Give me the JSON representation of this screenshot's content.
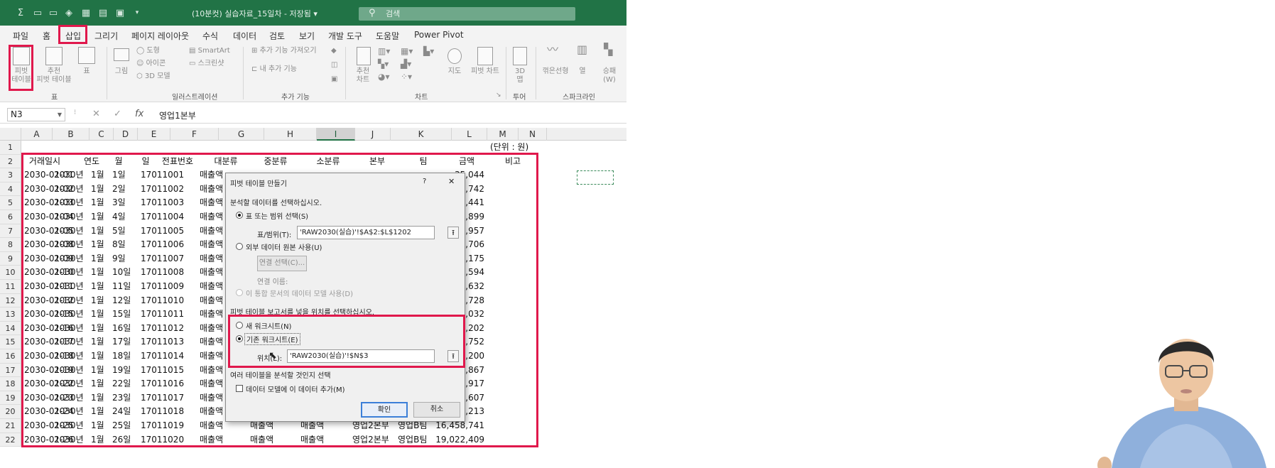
{
  "window": {
    "title": "(10분컷) 실습자료_15일차 - 저장됨 ▾",
    "search_placeholder": "검색"
  },
  "menu": [
    "파일",
    "홈",
    "삽입",
    "그리기",
    "페이지 레이아웃",
    "수식",
    "데이터",
    "검토",
    "보기",
    "개발 도구",
    "도움말",
    "Power Pivot"
  ],
  "ribbon": {
    "groups": [
      "표",
      "일러스트레이션",
      "추가 기능",
      "차트",
      "투어",
      "스파크라인"
    ],
    "pivot_table": "피벗\n테이블",
    "recommended_pivot": "추천\n피벗 테이블",
    "table": "표",
    "picture": "그림",
    "shapes": "도형",
    "icons": "아이콘",
    "models": "3D 모델",
    "smartart": "SmartArt",
    "screenshot": "스크린샷",
    "get_addins": "추가 기능 가져오기",
    "my_addins": "내 추가 기능",
    "recommended_charts": "추천\n차트",
    "maps": "지도",
    "pivot_chart": "피벗 차트",
    "map3d": "3D\n맵",
    "spark_line": "꺾은선형",
    "spark_column": "열",
    "spark_winloss": "승패\n(W)"
  },
  "formula_bar": {
    "name_box": "N3",
    "fx": "fx",
    "value": "영업1본부"
  },
  "columns": [
    "A",
    "B",
    "C",
    "D",
    "E",
    "F",
    "G",
    "H",
    "I",
    "J",
    "K",
    "L",
    "M",
    "N"
  ],
  "rows": [
    "1",
    "2",
    "3",
    "4",
    "5",
    "6",
    "7",
    "8",
    "9",
    "10",
    "11",
    "12",
    "13",
    "14",
    "15",
    "16",
    "17",
    "18",
    "19",
    "20",
    "21",
    "22"
  ],
  "unit_note": "(단위 : 원)",
  "headers": [
    "거래일시",
    "연도",
    "월",
    "일",
    "전표번호",
    "대분류",
    "중분류",
    "소분류",
    "본부",
    "팀",
    "금액",
    "비고"
  ],
  "data_rows": [
    {
      "date": "2030-01-01",
      "year": "2030년",
      "month": "1월",
      "day": "1일",
      "slip": "17011001",
      "cat": "매출액",
      "amount": "35,044"
    },
    {
      "date": "2030-01-02",
      "year": "2030년",
      "month": "1월",
      "day": "2일",
      "slip": "17011002",
      "cat": "매출액",
      "amount": "74,742"
    },
    {
      "date": "2030-01-03",
      "year": "2030년",
      "month": "1월",
      "day": "3일",
      "slip": "17011003",
      "cat": "매출액",
      "amount": "03,441"
    },
    {
      "date": "2030-01-04",
      "year": "2030년",
      "month": "1월",
      "day": "4일",
      "slip": "17011004",
      "cat": "매출액",
      "amount": "34,899"
    },
    {
      "date": "2030-01-05",
      "year": "2030년",
      "month": "1월",
      "day": "5일",
      "slip": "17011005",
      "cat": "매출액",
      "amount": "10,957"
    },
    {
      "date": "2030-01-08",
      "year": "2030년",
      "month": "1월",
      "day": "8일",
      "slip": "17011006",
      "cat": "매출액",
      "amount": "07,706"
    },
    {
      "date": "2030-01-09",
      "year": "2030년",
      "month": "1월",
      "day": "9일",
      "slip": "17011007",
      "cat": "매출액",
      "amount": "15,175"
    },
    {
      "date": "2030-01-10",
      "year": "2030년",
      "month": "1월",
      "day": "10일",
      "slip": "17011008",
      "cat": "매출액",
      "amount": "98,594"
    },
    {
      "date": "2030-01-11",
      "year": "2030년",
      "month": "1월",
      "day": "11일",
      "slip": "17011009",
      "cat": "매출액",
      "amount": "94,632"
    },
    {
      "date": "2030-01-12",
      "year": "2030년",
      "month": "1월",
      "day": "12일",
      "slip": "17011010",
      "cat": "매출액",
      "amount": "39,728"
    },
    {
      "date": "2030-01-15",
      "year": "2030년",
      "month": "1월",
      "day": "15일",
      "slip": "17011011",
      "cat": "매출액",
      "amount": "73,032"
    },
    {
      "date": "2030-01-16",
      "year": "2030년",
      "month": "1월",
      "day": "16일",
      "slip": "17011012",
      "cat": "매출액",
      "amount": "29,202"
    },
    {
      "date": "2030-01-17",
      "year": "2030년",
      "month": "1월",
      "day": "17일",
      "slip": "17011013",
      "cat": "매출액",
      "amount": "77,752"
    },
    {
      "date": "2030-01-18",
      "year": "2030년",
      "month": "1월",
      "day": "18일",
      "slip": "17011014",
      "cat": "매출액",
      "amount": "30,200"
    },
    {
      "date": "2030-01-19",
      "year": "2030년",
      "month": "1월",
      "day": "19일",
      "slip": "17011015",
      "cat": "매출액",
      "amount": "1,867"
    },
    {
      "date": "2030-01-22",
      "year": "2030년",
      "month": "1월",
      "day": "22일",
      "slip": "17011016",
      "cat": "매출액",
      "amount": "94,917"
    },
    {
      "date": "2030-01-23",
      "year": "2030년",
      "month": "1월",
      "day": "23일",
      "slip": "17011017",
      "cat": "매출액",
      "amount": "27,607"
    },
    {
      "date": "2030-01-24",
      "year": "2030년",
      "month": "1월",
      "day": "24일",
      "slip": "17011018",
      "cat": "매출액",
      "amount": "78,213"
    },
    {
      "date": "2030-01-25",
      "year": "2030년",
      "month": "1월",
      "day": "25일",
      "slip": "17011019",
      "cat": "매출액",
      "mid": "매출액",
      "sub": "매출액",
      "hq": "영업2본부",
      "team": "영업B팀",
      "amount": "16,458,741"
    },
    {
      "date": "2030-01-26",
      "year": "2030년",
      "month": "1월",
      "day": "26일",
      "slip": "17011020",
      "cat": "매출액",
      "mid": "매출액",
      "sub": "매출액",
      "hq": "영업2본부",
      "team": "영업B팀",
      "amount": "19,022,409"
    }
  ],
  "dialog": {
    "title": "피벗 테이블 만들기",
    "help": "?",
    "close": "✕",
    "choose_data": "분석할 데이터를 선택하십시오.",
    "opt_range": "표 또는 범위 선택(S)",
    "range_label": "표/범위(T):",
    "range_value": "'RAW2030(실습)'!$A$2:$L$1202",
    "opt_external": "외부 데이터 원본 사용(U)",
    "conn_button": "연결 선택(C)...",
    "conn_name": "연결 이름:",
    "opt_model": "이 통합 문서의 데이터 모델 사용(D)",
    "choose_location": "피벗 테이블 보고서를 넣을 위치를 선택하십시오.",
    "opt_new": "새 워크시트(N)",
    "opt_existing": "기존 워크시트(E)",
    "location_label": "위치(L):",
    "location_value": "'RAW2030(실습)'!$N$3",
    "multi_table": "여러 테이블을 분석할 것인지 선택",
    "add_model": "데이터 모델에 이 데이터 추가(M)",
    "ok": "확인",
    "cancel": "취소"
  },
  "colors": {
    "excel_green": "#217346",
    "highlight": "#e0184c"
  }
}
